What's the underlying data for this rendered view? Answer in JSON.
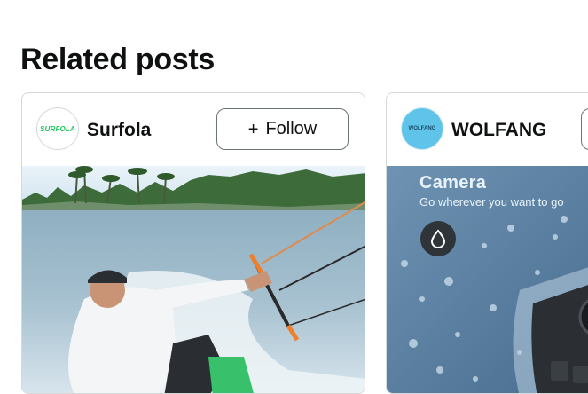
{
  "section": {
    "title": "Related posts"
  },
  "posts": [
    {
      "brand": "Surfola",
      "avatar_text": "SURFOLA",
      "follow_label": "Follow",
      "follow_icon": "+",
      "image": {
        "icon": "kitesurfer-photo"
      }
    },
    {
      "brand": "WOLFANG",
      "avatar_text": "WOLFANG",
      "follow_label": "",
      "image": {
        "icon": "action-camera-photo",
        "headline": "Camera",
        "subline": "Go wherever you want to go"
      }
    }
  ],
  "colors": {
    "text": "#0f1111",
    "card_border": "#d5d9d9",
    "button_border": "#6b7474",
    "surfola_green": "#1ec65b",
    "wolfang_blue": "#5fc3ea"
  }
}
